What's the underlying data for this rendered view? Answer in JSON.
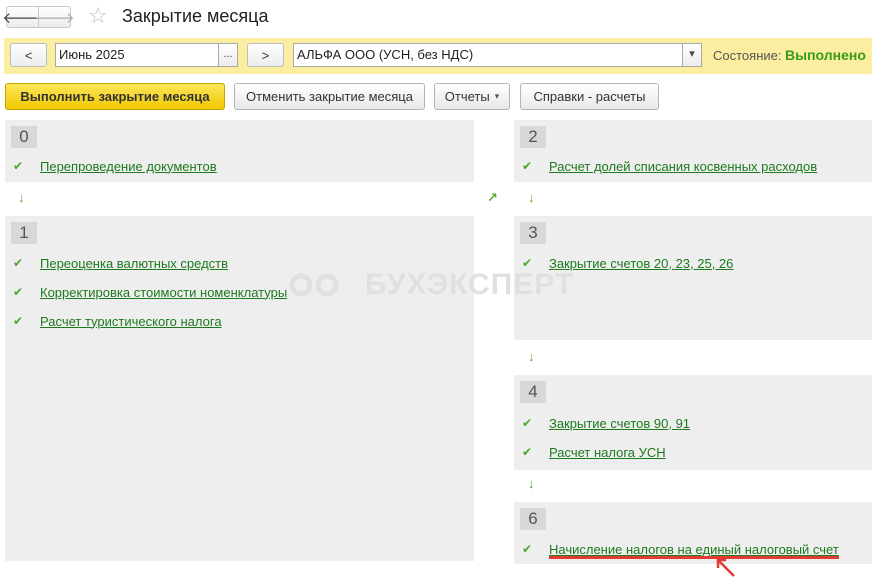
{
  "window": {
    "title": "Закрытие месяца"
  },
  "nav": {
    "back": "🡐",
    "forward": "🡒",
    "star": "☆"
  },
  "filter": {
    "prev_label": "<",
    "period": "Июнь 2025",
    "period_picker": "...",
    "next_label": ">",
    "organization": "АЛЬФА ООО (УСН, без НДС)",
    "org_dropdown": "▾",
    "state_label": "Состояние:",
    "state_value": "Выполнено"
  },
  "actions": {
    "execute": "Выполнить закрытие месяца",
    "cancel": "Отменить закрытие месяца",
    "reports": "Отчеты",
    "reports_caret": "▾",
    "references": "Справки - расчеты"
  },
  "check_glyph": "✔",
  "arrow_glyph": "↓",
  "diag_glyph": "↗",
  "watermark": "БУХЭКСПЕРТ",
  "blocks": {
    "b0": {
      "number": "0",
      "items": [
        "Перепроведение документов"
      ]
    },
    "b1": {
      "number": "1",
      "items": [
        "Переоценка валютных средств",
        "Корректировка стоимости номенклатуры",
        "Расчет туристического налога"
      ]
    },
    "b2": {
      "number": "2",
      "items": [
        "Расчет долей списания косвенных расходов"
      ]
    },
    "b3": {
      "number": "3",
      "items": [
        "Закрытие счетов 20, 23, 25, 26"
      ]
    },
    "b4": {
      "number": "4",
      "items": [
        "Закрытие счетов 90, 91",
        "Расчет налога УСН"
      ]
    },
    "b6": {
      "number": "6",
      "items": [
        "Начисление налогов на единый налоговый счет"
      ]
    }
  },
  "colors": {
    "accent_green": "#3a9a1c",
    "link_green": "#1d7a1d",
    "highlight_red": "#e53935",
    "filter_bg": "#fbeea0"
  }
}
